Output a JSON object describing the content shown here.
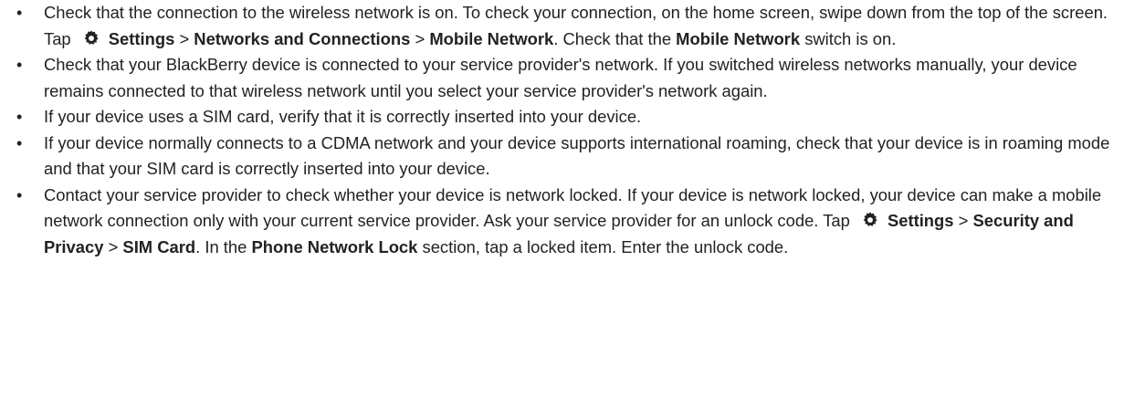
{
  "bullet_glyph": "•",
  "separator": " > ",
  "items": [
    {
      "t0": "Check that the connection to the wireless network is on. To check your connection, on the home screen, swipe down from the top of the screen. Tap ",
      "icon": "gear-icon",
      "b0": "Settings",
      "b1": "Networks and Connections",
      "b2": "Mobile Network",
      "t1": ". Check that the ",
      "b3": "Mobile Network",
      "t2": " switch is on."
    },
    {
      "text": "Check that your BlackBerry device is connected to your service provider's network. If you switched wireless networks manually, your device remains connected to that wireless network until you select your service provider's network again."
    },
    {
      "text": "If your device uses a SIM card, verify that it is correctly inserted into your device."
    },
    {
      "text": "If your device normally connects to a CDMA network and your device supports international roaming, check that your device is in roaming mode and that your SIM card is correctly inserted into your device."
    },
    {
      "t0": "Contact your service provider to check whether your device is network locked. If your device is network locked, your device can make a mobile network connection only with your current service provider. Ask your service provider for an unlock code. Tap ",
      "icon": "gear-icon",
      "b0": "Settings",
      "b1": "Security and Privacy",
      "b2": "SIM Card",
      "t1": ". In the ",
      "b3": "Phone Network Lock",
      "t2": " section, tap a locked item. Enter the unlock code."
    }
  ]
}
